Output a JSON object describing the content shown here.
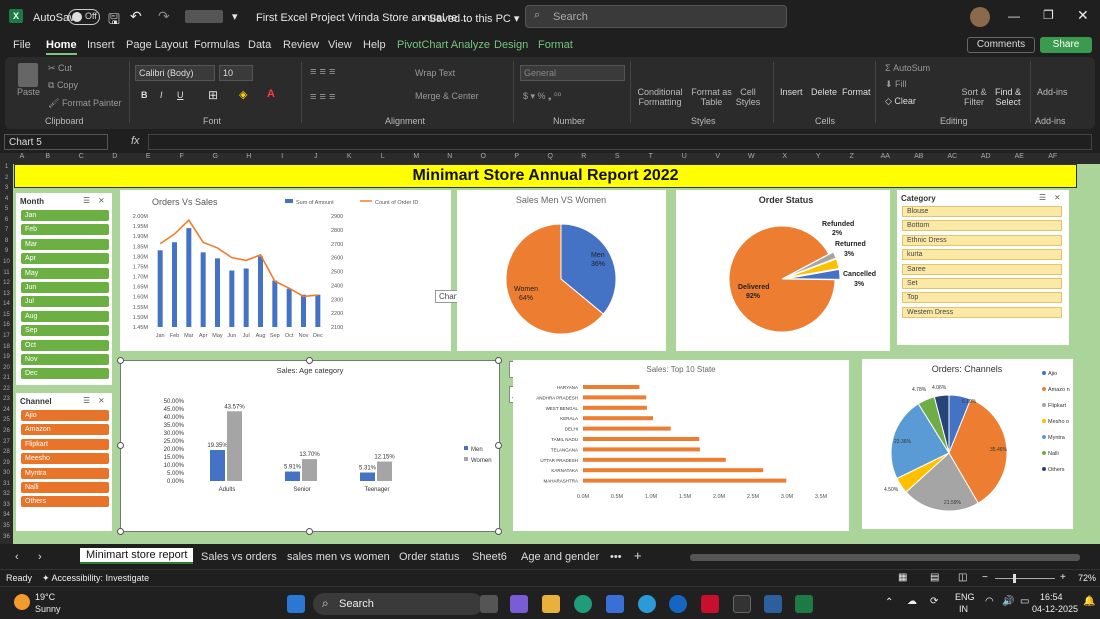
{
  "titlebar": {
    "autosave": "AutoSave",
    "toggle_state": "Off",
    "doc_title": "First Excel Project Vrinda Store annual re...",
    "saved": "Saved to this PC",
    "search_placeholder": "Search"
  },
  "menu": {
    "items": [
      "File",
      "Home",
      "Insert",
      "Page Layout",
      "Formulas",
      "Data",
      "Review",
      "View",
      "Help",
      "PivotChart Analyze",
      "Design",
      "Format"
    ],
    "comments": "Comments",
    "share": "Share"
  },
  "ribbon": {
    "clipboard": {
      "paste": "Paste",
      "cut": "Cut",
      "copy": "Copy",
      "format_painter": "Format Painter",
      "group": "Clipboard"
    },
    "font": {
      "family": "Calibri (Body)",
      "size": "10",
      "bold": "B",
      "italic": "I",
      "underline": "U",
      "group": "Font"
    },
    "alignment": {
      "wrap": "Wrap Text",
      "merge": "Merge & Center",
      "group": "Alignment"
    },
    "number": {
      "format": "General",
      "group": "Number"
    },
    "styles": {
      "conditional": "Conditional Formatting",
      "format_table": "Format as Table",
      "cell_styles": "Cell Styles",
      "group": "Styles"
    },
    "cells": {
      "insert": "Insert",
      "delete": "Delete",
      "format": "Format",
      "group": "Cells"
    },
    "editing": {
      "autosum": "AutoSum",
      "fill": "Fill",
      "clear": "Clear",
      "sort": "Sort & Filter",
      "find": "Find & Select",
      "group": "Editing"
    },
    "addins": {
      "label": "Add-ins",
      "group": "Add-ins"
    }
  },
  "formula_bar": {
    "name_box": "Chart 5",
    "fx": "fx",
    "value": ""
  },
  "columns": [
    "A",
    "B",
    "C",
    "D",
    "E",
    "F",
    "G",
    "H",
    "I",
    "J",
    "K",
    "L",
    "M",
    "N",
    "O",
    "P",
    "Q",
    "R",
    "S",
    "T",
    "U",
    "V",
    "W",
    "X",
    "Y",
    "Z",
    "AA",
    "AB",
    "AC",
    "AD",
    "AE",
    "AF"
  ],
  "rows": [
    "1",
    "2",
    "3",
    "4",
    "5",
    "6",
    "7",
    "8",
    "9",
    "10",
    "11",
    "12",
    "13",
    "14",
    "15",
    "16",
    "17",
    "18",
    "19",
    "20",
    "21",
    "22",
    "23",
    "24",
    "25",
    "26",
    "27",
    "28",
    "29",
    "30",
    "31",
    "32",
    "33",
    "34",
    "35",
    "36"
  ],
  "dashboard": {
    "title": "Minimart Store Annual Report 2022",
    "tooltip": "Chart Area"
  },
  "month_slicer": {
    "title": "Month",
    "items": [
      "Jan",
      "Feb",
      "Mar",
      "Apr",
      "May",
      "Jun",
      "Jul",
      "Aug",
      "Sep",
      "Oct",
      "Nov",
      "Dec"
    ],
    "color": "#6cb043"
  },
  "channel_slicer": {
    "title": "Channel",
    "items": [
      "Ajio",
      "Amazon",
      "Flipkart",
      "Meesho",
      "Myntra",
      "Nalli",
      "Others"
    ],
    "color": "#e8742a"
  },
  "category_slicer": {
    "title": "Category",
    "items": [
      "Blouse",
      "Bottom",
      "Ethnic Dress",
      "kurta",
      "Saree",
      "Set",
      "Top",
      "Western Dress"
    ]
  },
  "chart_data": [
    {
      "type": "bar+line",
      "title": "Orders Vs Sales",
      "categories": [
        "Jan",
        "Feb",
        "Mar",
        "Apr",
        "May",
        "Jun",
        "Jul",
        "Aug",
        "Sep",
        "Oct",
        "Nov",
        "Dec"
      ],
      "series": [
        {
          "name": "Sum of Amount",
          "type": "bar",
          "color": "#4472c4",
          "values": [
            1.83,
            1.87,
            1.94,
            1.82,
            1.79,
            1.73,
            1.74,
            1.8,
            1.68,
            1.64,
            1.61,
            1.61
          ]
        },
        {
          "name": "Count of Order ID",
          "type": "line",
          "color": "#ed7d31",
          "values": [
            2700,
            2770,
            2870,
            2710,
            2670,
            2600,
            2580,
            2620,
            2430,
            2380,
            2320,
            2330
          ]
        }
      ],
      "y_ticks": [
        "2.00M",
        "1.95M",
        "1.90M",
        "1.85M",
        "1.80M",
        "1.75M",
        "1.70M",
        "1.65M",
        "1.60M",
        "1.55M",
        "1.50M",
        "1.45M"
      ],
      "ylim": [
        1.45,
        2.0
      ],
      "y2_ticks": [
        "2900",
        "2800",
        "2700",
        "2600",
        "2500",
        "2400",
        "2300",
        "2200",
        "2100"
      ],
      "y2lim": [
        2100,
        2900
      ]
    },
    {
      "type": "pie",
      "title": "Sales Men VS Women",
      "slices": [
        {
          "label": "Men",
          "pct": "36%",
          "value": 36,
          "color": "#4472c4"
        },
        {
          "label": "Women",
          "pct": "64%",
          "value": 64,
          "color": "#ed7d31"
        }
      ]
    },
    {
      "type": "pie",
      "title": "Order Status",
      "slices": [
        {
          "label": "Delivered",
          "pct": "92%",
          "value": 92,
          "color": "#ed7d31"
        },
        {
          "label": "Refunded",
          "pct": "2%",
          "value": 2,
          "color": "#a5a5a5"
        },
        {
          "label": "Returned",
          "pct": "3%",
          "value": 3,
          "color": "#ffc000"
        },
        {
          "label": "Cancelled",
          "pct": "3%",
          "value": 3,
          "color": "#4472c4"
        }
      ]
    },
    {
      "type": "bar",
      "title": "Sales: Age category",
      "categories": [
        "Adults",
        "Senior",
        "Teenager"
      ],
      "series": [
        {
          "name": "Men",
          "color": "#4472c4",
          "values": [
            19.35,
            5.91,
            5.31
          ],
          "labels": [
            "19.35%",
            "5.91%",
            "5.31%"
          ]
        },
        {
          "name": "Women",
          "color": "#a5a5a5",
          "values": [
            43.57,
            13.7,
            12.15
          ],
          "labels": [
            "43.57%",
            "13.70%",
            "12.15%"
          ]
        }
      ],
      "y_ticks": [
        "50.00%",
        "45.00%",
        "40.00%",
        "35.00%",
        "30.00%",
        "25.00%",
        "20.00%",
        "15.00%",
        "10.00%",
        "5.00%",
        "0.00%"
      ],
      "ylim": [
        0,
        50
      ]
    },
    {
      "type": "bar",
      "orientation": "horizontal",
      "title": "Sales: Top 10 State",
      "color": "#ed7d31",
      "categories": [
        "HARYANA",
        "ANDHRA PRADESH",
        "WEST BENGAL",
        "KERALA",
        "DELHI",
        "TAMIL NADU",
        "TELANGANA",
        "UTTAR PRADESH",
        "KARNATAKA",
        "MAHARASHTRA"
      ],
      "values": [
        0.83,
        0.93,
        0.94,
        1.03,
        1.29,
        1.71,
        1.72,
        2.1,
        2.65,
        2.99
      ],
      "x_ticks": [
        "0.0M",
        "0.5M",
        "1.0M",
        "1.5M",
        "2.0M",
        "2.5M",
        "3.0M",
        "3.5M"
      ],
      "xlim": [
        0,
        3.5
      ]
    },
    {
      "type": "pie",
      "title": "Orders: Channels",
      "slices": [
        {
          "label": "Ajio",
          "pct": "6.10%",
          "value": 6.1,
          "color": "#4472c4"
        },
        {
          "label": "Amazon",
          "pct": "35.46%",
          "value": 35.46,
          "color": "#ed7d31"
        },
        {
          "label": "Flipkart",
          "pct": "21.59%",
          "value": 21.59,
          "color": "#a5a5a5"
        },
        {
          "label": "Meesho",
          "pct": "4.50%",
          "value": 4.5,
          "color": "#ffc000"
        },
        {
          "label": "Myntra",
          "pct": "23.36%",
          "value": 23.36,
          "color": "#5b9bd5"
        },
        {
          "label": "Nalli",
          "pct": "4.78%",
          "value": 4.78,
          "color": "#70ad47"
        },
        {
          "label": "Others",
          "pct": "4.06%",
          "value": 4.06,
          "color": "#264478"
        }
      ],
      "legend": [
        "Ajio",
        "Amazo n",
        "Flipkart",
        "Mesho o",
        "Myntra",
        "Nalli",
        "Others"
      ]
    }
  ],
  "sheet_tabs": {
    "items": [
      "Minimart store report",
      "Sales vs orders",
      "sales men vs women",
      "Order status",
      "Sheet6",
      "Age and gender"
    ],
    "more": "•••",
    "add": "+"
  },
  "status": {
    "ready": "Ready",
    "accessibility": "Accessibility: Investigate",
    "zoom": "72%"
  },
  "taskbar": {
    "temp": "19°C",
    "weather": "Sunny",
    "search": "Search",
    "lang1": "ENG",
    "lang2": "IN",
    "time": "16:54",
    "date": "04-12-2025"
  }
}
